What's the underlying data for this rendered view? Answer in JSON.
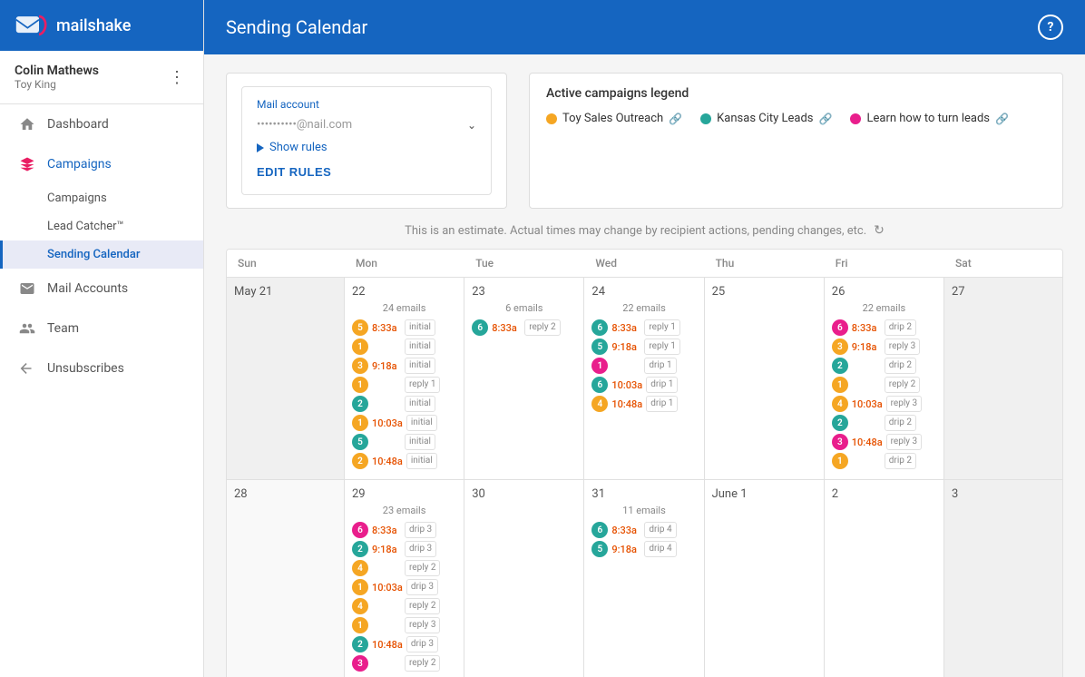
{
  "sidebar": {
    "logo": "mailshake",
    "user": {
      "name": "Colin Mathews",
      "company": "Toy King"
    },
    "nav": [
      {
        "id": "dashboard",
        "label": "Dashboard",
        "icon": "home"
      },
      {
        "id": "campaigns",
        "label": "Campaigns",
        "icon": "campaigns",
        "active": true,
        "children": [
          {
            "id": "campaigns-sub",
            "label": "Campaigns"
          },
          {
            "id": "lead-catcher",
            "label": "Lead Catcher™"
          },
          {
            "id": "sending-calendar",
            "label": "Sending Calendar",
            "active": true
          }
        ]
      },
      {
        "id": "mail-accounts",
        "label": "Mail Accounts",
        "icon": "mail"
      },
      {
        "id": "team",
        "label": "Team",
        "icon": "team"
      },
      {
        "id": "unsubscribes",
        "label": "Unsubscribes",
        "icon": "unsubscribes"
      }
    ]
  },
  "header": {
    "title": "Sending Calendar",
    "help_label": "?"
  },
  "mail_account": {
    "label": "Mail account",
    "email": "••••••••••@nail.com",
    "show_rules": "Show rules",
    "edit_rules": "EDIT RULES"
  },
  "legend": {
    "title": "Active campaigns legend",
    "items": [
      {
        "label": "Toy Sales Outreach",
        "color": "#f5a623"
      },
      {
        "label": "Kansas City Leads",
        "color": "#26a69a"
      },
      {
        "label": "Learn how to turn leads",
        "color": "#e91e8c"
      }
    ]
  },
  "estimate_text": "This is an estimate. Actual times may change by recipient actions, pending changes, etc.",
  "calendar": {
    "day_headers": [
      "Sun",
      "Mon",
      "Tue",
      "Wed",
      "Thu",
      "Fri",
      "Sat"
    ],
    "weeks": [
      {
        "cells": [
          {
            "date": "May 21",
            "type": "other",
            "entries": []
          },
          {
            "date": "22",
            "emails": "24 emails",
            "entries": [
              {
                "badge": "5",
                "color": "orange",
                "time": "8:33a",
                "type": "initial"
              },
              {
                "badge": "1",
                "color": "orange",
                "time": "",
                "type": "initial"
              },
              {
                "badge": "3",
                "color": "orange",
                "time": "9:18a",
                "type": "initial"
              },
              {
                "badge": "1",
                "color": "orange",
                "time": "",
                "type": "reply 1"
              },
              {
                "badge": "2",
                "color": "teal",
                "time": "",
                "type": "initial"
              },
              {
                "badge": "1",
                "color": "orange",
                "time": "10:03a",
                "type": "initial"
              },
              {
                "badge": "5",
                "color": "teal",
                "time": "",
                "type": "initial"
              },
              {
                "badge": "2",
                "color": "orange",
                "time": "10:48a",
                "type": "initial"
              }
            ]
          },
          {
            "date": "23",
            "emails": "6 emails",
            "entries": [
              {
                "badge": "6",
                "color": "teal",
                "time": "8:33a",
                "type": "reply 2"
              }
            ]
          },
          {
            "date": "24",
            "emails": "22 emails",
            "entries": [
              {
                "badge": "6",
                "color": "teal",
                "time": "8:33a",
                "type": "reply 1"
              },
              {
                "badge": "5",
                "color": "teal",
                "time": "9:18a",
                "type": "reply 1"
              },
              {
                "badge": "1",
                "color": "pink",
                "time": "",
                "type": "drip 1"
              },
              {
                "badge": "6",
                "color": "teal",
                "time": "10:03a",
                "type": "drip 1"
              },
              {
                "badge": "4",
                "color": "orange",
                "time": "10:48a",
                "type": "drip 1"
              }
            ]
          },
          {
            "date": "25",
            "entries": []
          },
          {
            "date": "26",
            "emails": "22 emails",
            "entries": [
              {
                "badge": "6",
                "color": "pink",
                "time": "8:33a",
                "type": "drip 2"
              },
              {
                "badge": "3",
                "color": "orange",
                "time": "9:18a",
                "type": "reply 3"
              },
              {
                "badge": "2",
                "color": "teal",
                "time": "",
                "type": "drip 2"
              },
              {
                "badge": "1",
                "color": "orange",
                "time": "",
                "type": "reply 2"
              },
              {
                "badge": "4",
                "color": "orange",
                "time": "10:03a",
                "type": "reply 3"
              },
              {
                "badge": "2",
                "color": "teal",
                "time": "",
                "type": "drip 2"
              },
              {
                "badge": "3",
                "color": "pink",
                "time": "10:48a",
                "type": "reply 3"
              },
              {
                "badge": "1",
                "color": "orange",
                "time": "",
                "type": "drip 2"
              }
            ]
          },
          {
            "date": "27",
            "type": "weekend",
            "entries": []
          }
        ]
      },
      {
        "cells": [
          {
            "date": "28",
            "type": "weekend",
            "entries": []
          },
          {
            "date": "29",
            "emails": "23 emails",
            "entries": [
              {
                "badge": "6",
                "color": "pink",
                "time": "8:33a",
                "type": "drip 3"
              },
              {
                "badge": "2",
                "color": "teal",
                "time": "9:18a",
                "type": "drip 3"
              },
              {
                "badge": "4",
                "color": "orange",
                "time": "",
                "type": "reply 2"
              },
              {
                "badge": "1",
                "color": "orange",
                "time": "10:03a",
                "type": "drip 3"
              },
              {
                "badge": "4",
                "color": "orange",
                "time": "",
                "type": "reply 2"
              },
              {
                "badge": "1",
                "color": "orange",
                "time": "",
                "type": "reply 3"
              },
              {
                "badge": "2",
                "color": "teal",
                "time": "10:48a",
                "type": "drip 3"
              },
              {
                "badge": "3",
                "color": "pink",
                "time": "",
                "type": "reply 2"
              }
            ]
          },
          {
            "date": "30",
            "entries": []
          },
          {
            "date": "31",
            "emails": "11 emails",
            "entries": [
              {
                "badge": "6",
                "color": "teal",
                "time": "8:33a",
                "type": "drip 4"
              },
              {
                "badge": "5",
                "color": "teal",
                "time": "9:18a",
                "type": "drip 4"
              }
            ]
          },
          {
            "date": "June 1",
            "entries": []
          },
          {
            "date": "2",
            "entries": []
          },
          {
            "date": "3",
            "type": "weekend",
            "entries": []
          }
        ]
      }
    ]
  }
}
